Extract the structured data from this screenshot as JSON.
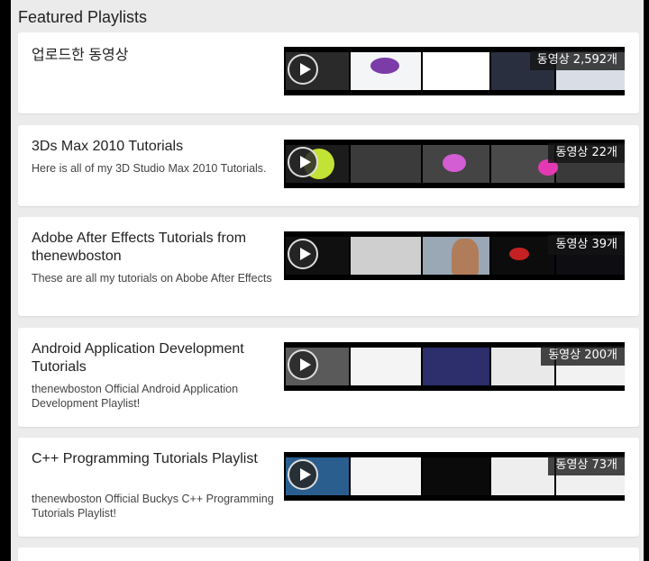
{
  "section": {
    "title": "Featured Playlists"
  },
  "playlists": [
    {
      "title": "업로드한 동영상",
      "description": "",
      "count": "동영상 2,592개"
    },
    {
      "title": "3Ds Max 2010 Tutorials",
      "description": "Here is all of my 3D Studio Max 2010 Tutorials.",
      "count": "동영상 22개"
    },
    {
      "title": "Adobe After Effects Tutorials from thenewboston",
      "description": "These are all my tutorials on Abobe After Effects",
      "count": "동영상 39개"
    },
    {
      "title": "Android Application Development Tutorials",
      "description": "thenewboston Official Android Application Development Playlist!",
      "count": "동영상 200개"
    },
    {
      "title": "C++ Programming Tutorials Playlist",
      "description": "thenewboston Official Buckys C++ Programming Tutorials Playlist!",
      "count": "동영상 73개"
    }
  ],
  "icons": {
    "play": "play-icon"
  }
}
